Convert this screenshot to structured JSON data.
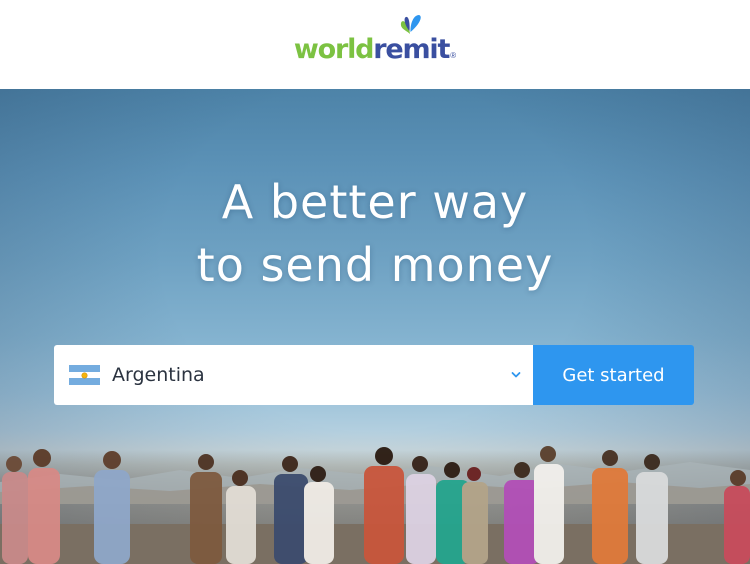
{
  "brand": {
    "logo_world": "world",
    "logo_remit": "remit",
    "registered_mark": "®",
    "colors": {
      "world_green": "#7cc242",
      "remit_blue": "#3a4fa0",
      "button_blue": "#2e96ef"
    },
    "icon": "butterfly-icon"
  },
  "hero": {
    "headline_line1": "A better way",
    "headline_line2": "to send money"
  },
  "send_form": {
    "selected_country": "Argentina",
    "flag_icon": "argentina-flag-icon",
    "dropdown_icon": "chevron-down-icon",
    "cta_label": "Get started"
  }
}
